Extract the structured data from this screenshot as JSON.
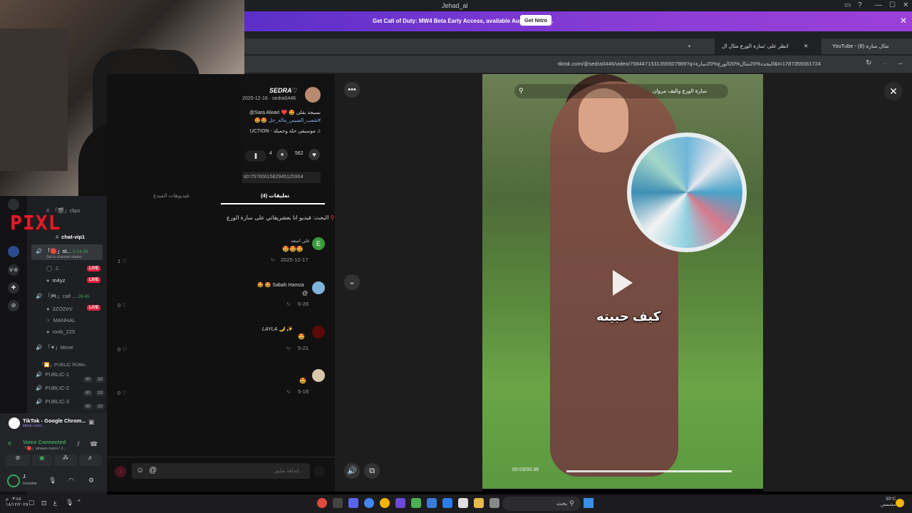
{
  "window": {
    "title": "Jehad_al"
  },
  "banner": {
    "text": "Get Call of Duty: MW4 Beta Early Access, available August 21 – 25.",
    "button": "Get Nitro",
    "close": "✕"
  },
  "browser": {
    "tabs": [
      {
        "label": "YouTube - (8) مثال ساره",
        "close": "✕"
      },
      {
        "label": "انظر على 'ساره الورع مثال ال",
        "close": "✕"
      }
    ],
    "new_tab": "+",
    "url": "tiktok.com/@sedra0446/video/7584471531355507989?q=البحث%20مثال%20الورع%20سارة&t=1787359361724"
  },
  "discord": {
    "pixl_logo": "PIXL",
    "channels": [
      {
        "icon": "#",
        "label": "photos"
      },
      {
        "icon": "#",
        "label": "「🎬」clips"
      },
      {
        "icon": "#",
        "label": "chat-vip1"
      },
      {
        "icon": "🔊",
        "label": "「🔴」st...",
        "timer": "3:24:38",
        "status": "Set a channel status"
      },
      {
        "icon": "🔊",
        "label": "「🎮」call ...",
        "timer": "26:45"
      },
      {
        "icon": "🔊",
        "label": "「⚫」Move"
      },
      {
        "icon": "📁",
        "label": "「🎦」PUBLIC ROMs"
      },
      {
        "icon": "🔊",
        "label": "PUBLIC-1",
        "count1": "00",
        "count2": "10"
      },
      {
        "icon": "🔊",
        "label": "PUBLIC-2",
        "count1": "00",
        "count2": "10"
      },
      {
        "icon": "🔊",
        "label": "PUBLIC-3",
        "count1": "00",
        "count2": "10"
      }
    ],
    "voice_users": [
      {
        "name": "J.",
        "live": "LIVE"
      },
      {
        "name": "m4yz",
        "live": "LIVE"
      },
      {
        "name": "3ZOZeV",
        "live": "LIVE"
      },
      {
        "name": "MANHAL"
      },
      {
        "name": "roob_225"
      }
    ],
    "activity": {
      "title": "TikTok - Google Chrom...",
      "sub": "tiktok.com/..."
    },
    "voice": {
      "status": "Voice Connected",
      "channel": "「🔴」stream room / J..."
    },
    "user": {
      "name": "J.",
      "status": "Invisible"
    }
  },
  "tiktok": {
    "author": {
      "name": "SEDRA♡",
      "handle": "sedra0446",
      "date": "2025-12-16"
    },
    "desc_line1": "نسيجة بقلي 🤩 ❤️ Sara Alwari@",
    "desc_line2": "#شعب_الصيني_ماله_حل 🤩🤩",
    "music": "♫ موسيقى حلة وجميلة - UCTION",
    "stats": {
      "likes": "562",
      "comments": "4"
    },
    "video_id": "id=7576561582945125904",
    "tabs": {
      "comments": "تعليقات (4)",
      "creator": "فيديوهات المبدع"
    },
    "search_hint": "البحث: فيديو انا بعشريقاتي على سارة الورع",
    "comments": [
      {
        "user": "علي اسعد",
        "text": "🤩🤩🤩",
        "date": "2025-12-17",
        "likes": "1",
        "reply": "رد"
      },
      {
        "user": "Sabah Hamza",
        "text": "🤩 🤩",
        "date": "6-28",
        "likes": "0",
        "reply": "رد"
      },
      {
        "user": "LAYLA 🌙 ✨",
        "text": "🤩",
        "date": "5-21",
        "likes": "0",
        "reply": "رد"
      },
      {
        "user": "",
        "text": "🤩",
        "date": "5-18",
        "likes": "0",
        "reply": "رد"
      }
    ],
    "comment_placeholder": "إضافة تعليق...",
    "video": {
      "search": "سارة الورع واليف مروان",
      "caption": "كيف حبيته",
      "time": "00:03/00:38"
    }
  },
  "taskbar": {
    "time": "٠٣:٤٥ م",
    "date": "١٨/١٢/٢٠٢٥",
    "weather": "39°C",
    "weather_desc": "مشمس",
    "search": "بحث"
  }
}
